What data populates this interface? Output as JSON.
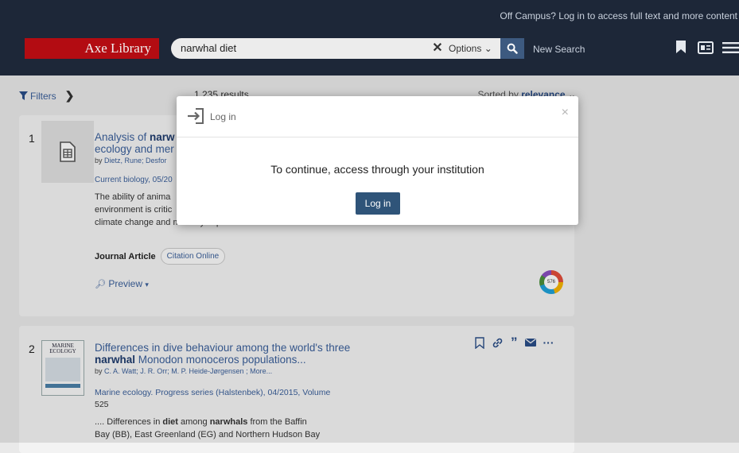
{
  "header": {
    "offcampus_text": "Off Campus? Log in to access full text and more content",
    "logo_text": "Axe Library",
    "search_value": "narwhal diet",
    "options_label": "Options",
    "new_search_label": "New Search"
  },
  "toolbar": {
    "filters_label": "Filters",
    "results_count": "1,235 results",
    "sorted_prefix": "Sorted by",
    "sorted_value": "relevance"
  },
  "results": [
    {
      "number": "1",
      "title_part1": "Analysis of ",
      "title_bold": "narw",
      "title_line2": "ecology and mer",
      "authors_prefix": "by ",
      "authors": "Dietz, Rune; Desfor",
      "source": "Current biology, 05/20",
      "abstract_line1": "The ability of anima",
      "abstract_line2": "environment is critic",
      "abstract_line3": "climate change and mercury exposure are two...",
      "type": "Journal Article",
      "citation_pill": "Citation Online",
      "preview_label": "Preview",
      "altmetric_score": "576"
    },
    {
      "number": "2",
      "title_line1": "Differences in dive behaviour among the world's three",
      "title_bold": "narwhal",
      "title_line2_rest": " Monodon monoceros populations...",
      "authors_prefix": "by ",
      "authors": "C. A. Watt; J. R. Orr; M. P. Heide-Jørgensen ; More...",
      "source_line1": "Marine ecology. Progress series (Halstenbek), 04/2015, Volume",
      "source_line2": "525",
      "abstract_line1_a": ".... Differences in ",
      "abstract_line1_b": "diet",
      "abstract_line1_c": " among ",
      "abstract_line1_d": "narwhals",
      "abstract_line1_e": " from the Baffin",
      "abstract_line2": "Bay (BB), East Greenland (EG) and Northern Hudson Bay",
      "cover_title": "MARINE ECOLOGY"
    }
  ],
  "modal": {
    "title": "Log in",
    "close": "×",
    "message": "To continue, access through your institution",
    "button_label": "Log in"
  }
}
